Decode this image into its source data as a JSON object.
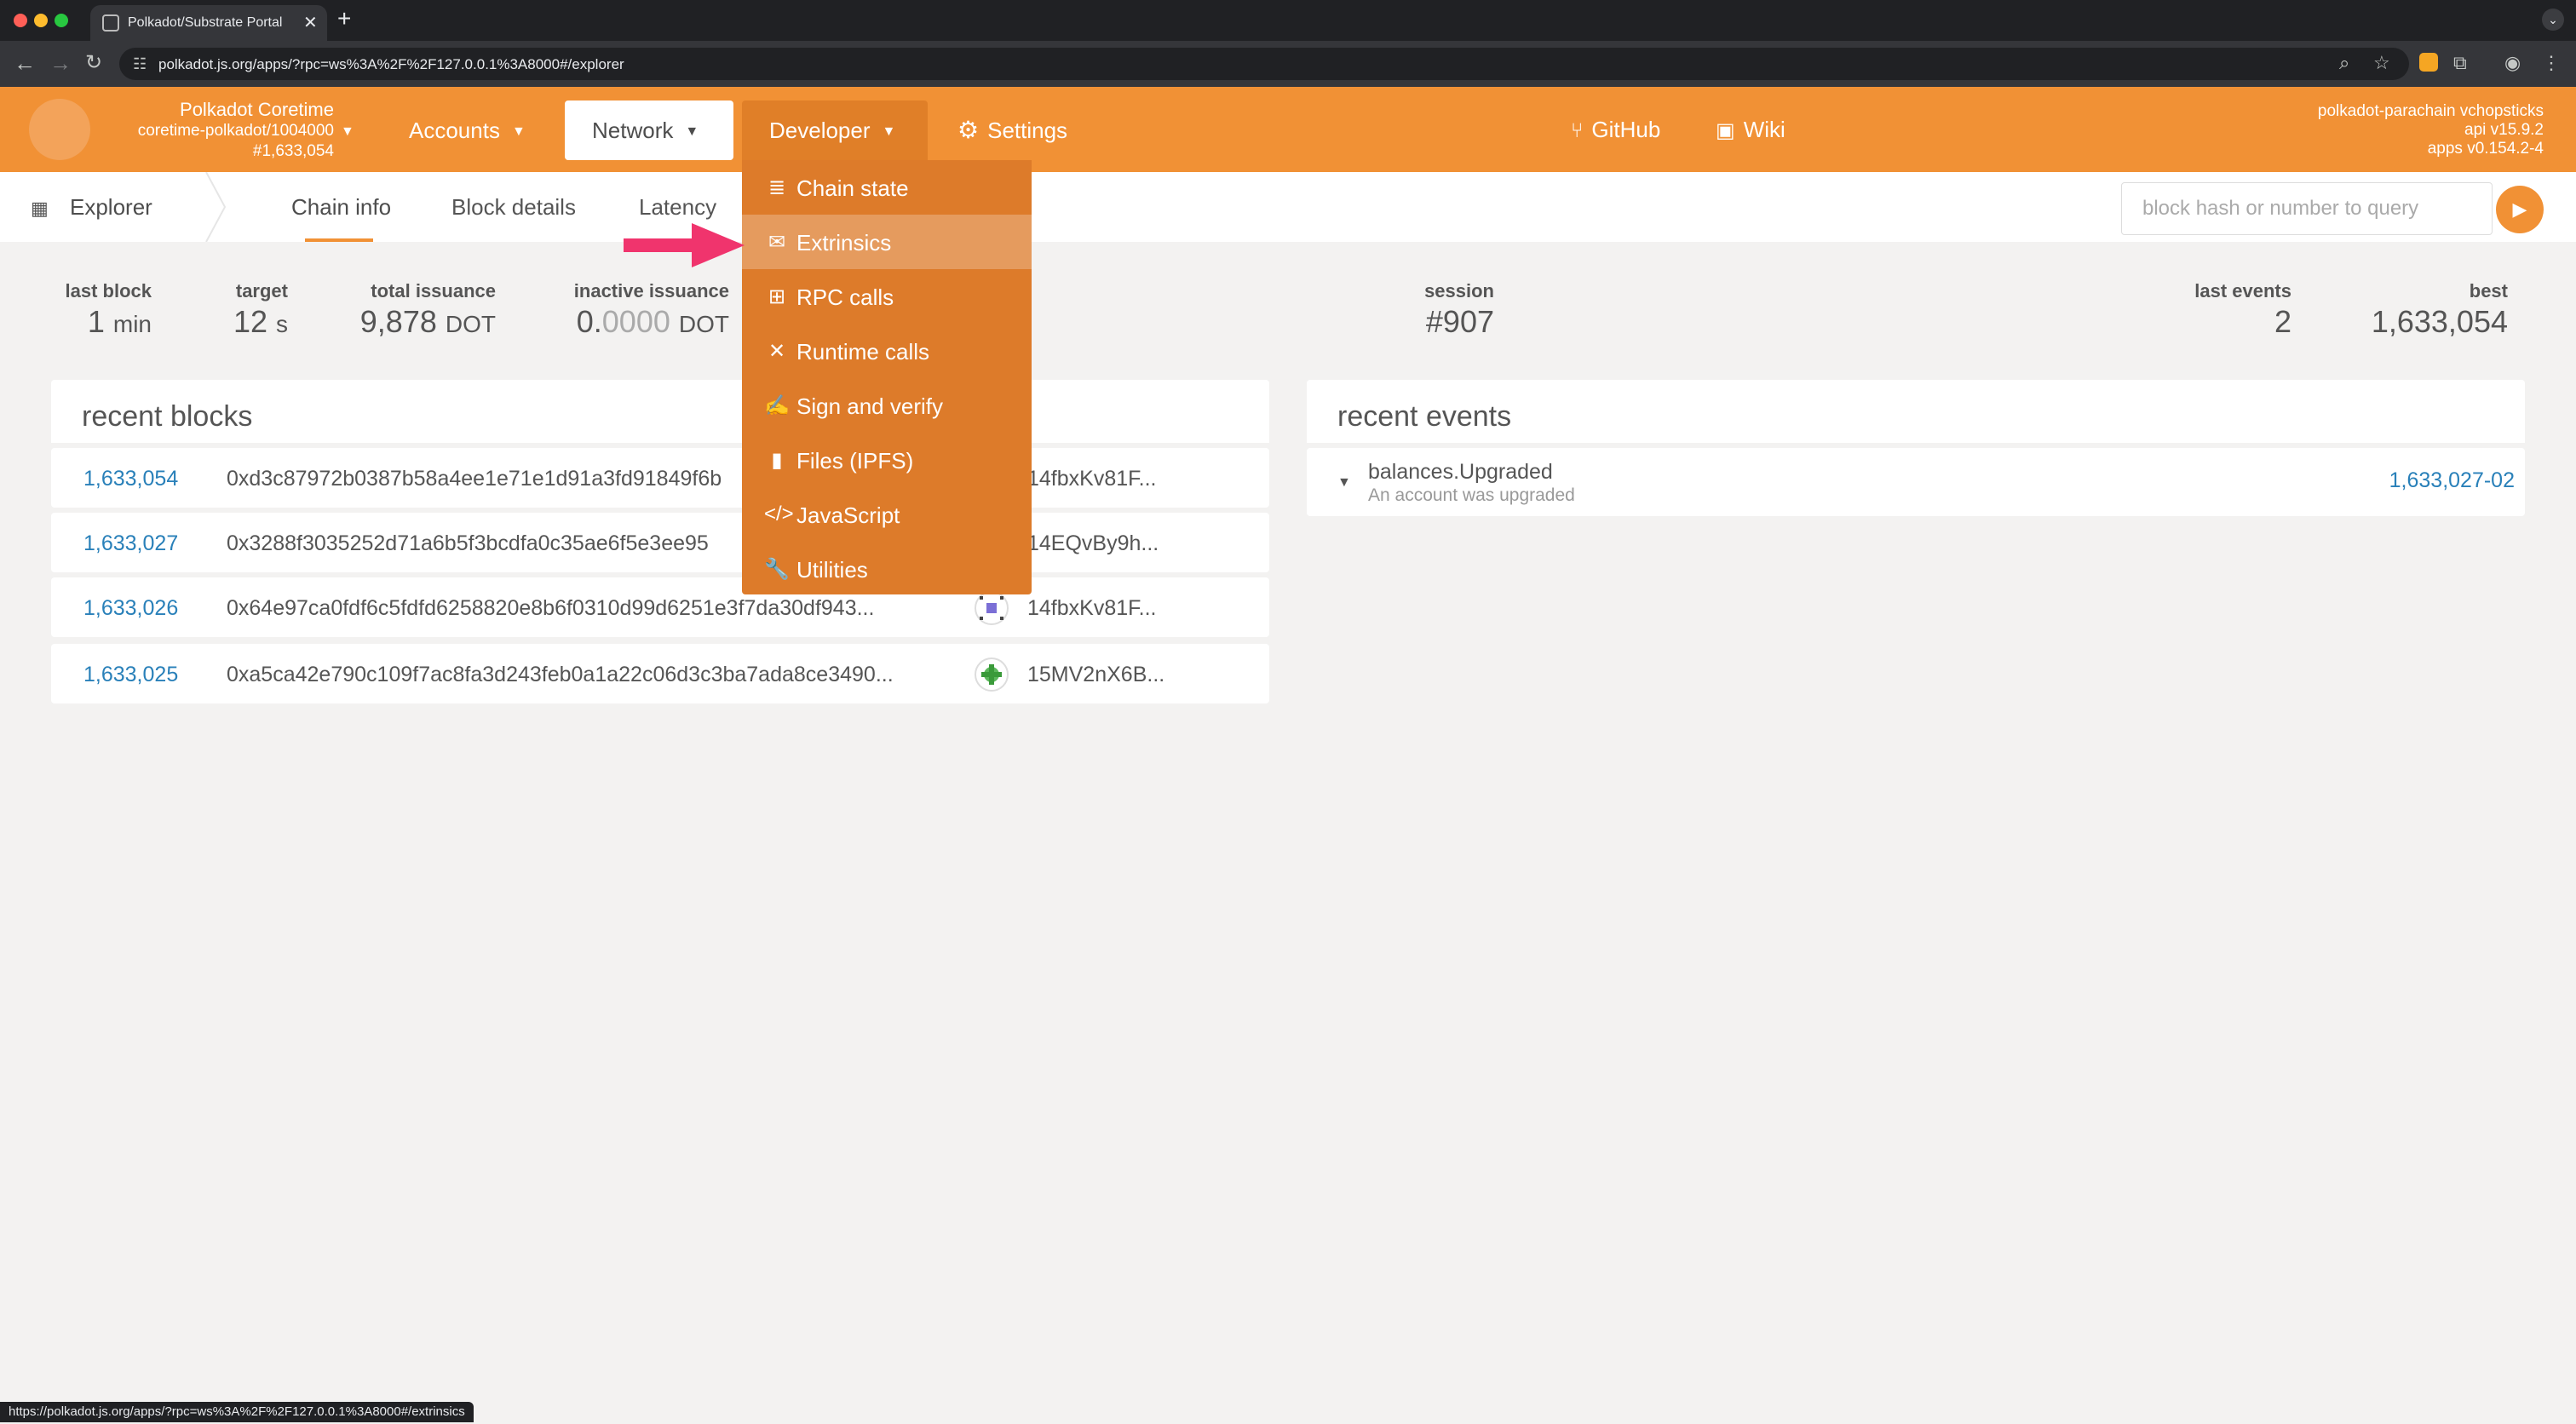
{
  "browser": {
    "tab_title": "Polkadot/Substrate Portal",
    "url": "polkadot.js.org/apps/?rpc=ws%3A%2F%2F127.0.0.1%3A8000#/explorer",
    "status_url": "https://polkadot.js.org/apps/?rpc=ws%3A%2F%2F127.0.0.1%3A8000#/extrinsics"
  },
  "header": {
    "chain_name": "Polkadot Coretime",
    "chain_runtime": "coretime-polkadot/1004000",
    "chain_block": "#1,633,054",
    "menu": {
      "accounts": "Accounts",
      "network": "Network",
      "developer": "Developer",
      "settings": "Settings"
    },
    "links": {
      "github": "GitHub",
      "wiki": "Wiki"
    },
    "version": {
      "node": "polkadot-parachain vchopsticks",
      "api": "api v15.9.2",
      "apps": "apps v0.154.2-4"
    }
  },
  "developer_menu": [
    {
      "label": "Chain state",
      "icon": "database-icon"
    },
    {
      "label": "Extrinsics",
      "icon": "envelope-icon"
    },
    {
      "label": "RPC calls",
      "icon": "network-icon"
    },
    {
      "label": "Runtime calls",
      "icon": "compress-icon"
    },
    {
      "label": "Sign and verify",
      "icon": "signature-icon"
    },
    {
      "label": "Files (IPFS)",
      "icon": "file-icon"
    },
    {
      "label": "JavaScript",
      "icon": "code-icon"
    },
    {
      "label": "Utilities",
      "icon": "wrench-icon"
    }
  ],
  "subnav": {
    "section": "Explorer",
    "tabs": [
      "Chain info",
      "Block details",
      "Latency"
    ],
    "query_placeholder": "block hash or number to query"
  },
  "summary": {
    "last_block": {
      "label": "last block",
      "value": "1",
      "unit": "min"
    },
    "target": {
      "label": "target",
      "value": "12",
      "unit": "s"
    },
    "total_issuance": {
      "label": "total issuance",
      "value": "9,878",
      "unit": "DOT"
    },
    "inactive_issuance": {
      "label": "inactive issuance",
      "value": "0.",
      "value_faint": "0000",
      "unit": "DOT"
    },
    "session": {
      "label": "session",
      "value": "#907"
    },
    "last_events": {
      "label": "last events",
      "value": "2"
    },
    "best": {
      "label": "best",
      "value": "1,633,054"
    }
  },
  "recent_blocks": {
    "title": "recent blocks",
    "rows": [
      {
        "number": "1,633,054",
        "hash": "0xd3c87972b0387b58a4ee1e71e1d91a3fd91849f6b",
        "author": "14fbxKv81F..."
      },
      {
        "number": "1,633,027",
        "hash": "0x3288f3035252d71a6b5f3bcdfa0c35ae6f5e3ee95",
        "author": "14EQvBy9h..."
      },
      {
        "number": "1,633,026",
        "hash": "0x64e97ca0fdf6c5fdfd6258820e8b6f0310d99d6251e3f7da30df943...",
        "author": "14fbxKv81F..."
      },
      {
        "number": "1,633,025",
        "hash": "0xa5ca42e790c109f7ac8fa3d243feb0a1a22c06d3c3ba7ada8ce3490...",
        "author": "15MV2nX6B..."
      }
    ]
  },
  "recent_events": {
    "title": "recent events",
    "rows": [
      {
        "name": "balances.Upgraded",
        "description": "An account was upgraded",
        "id": "1,633,027-02"
      }
    ]
  },
  "colors": {
    "accent": "#f19135",
    "dropdown": "#dd7b2a",
    "link": "#2980b9",
    "arrow": "#f0346d"
  }
}
